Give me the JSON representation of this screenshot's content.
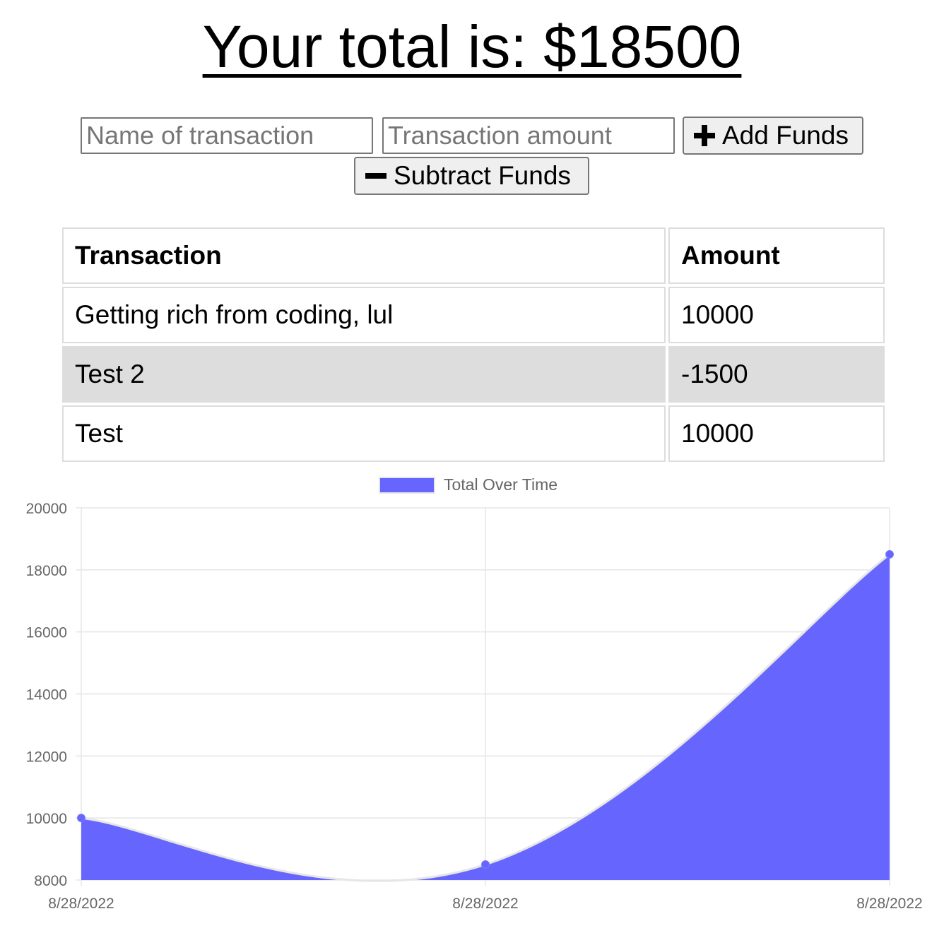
{
  "header": {
    "title": "Your total is: $18500"
  },
  "form": {
    "name_placeholder": "Name of transaction",
    "amount_placeholder": "Transaction amount",
    "add_label": "Add Funds",
    "subtract_label": "Subtract Funds"
  },
  "table": {
    "headers": [
      "Transaction",
      "Amount"
    ],
    "rows": [
      {
        "name": "Getting rich from coding, lul",
        "amount": "10000"
      },
      {
        "name": "Test 2",
        "amount": "-1500"
      },
      {
        "name": "Test",
        "amount": "10000"
      }
    ]
  },
  "colors": {
    "fill": "#6666ff",
    "line": "#e6e6e6",
    "row_alt": "#dddddd"
  },
  "chart_data": {
    "type": "area",
    "x": [
      "8/28/2022",
      "8/28/2022",
      "8/28/2022"
    ],
    "series": [
      {
        "name": "Total Over Time",
        "values": [
          10000,
          8500,
          18500
        ]
      }
    ],
    "ylim": [
      8000,
      20000
    ],
    "yticks": [
      8000,
      10000,
      12000,
      14000,
      16000,
      18000,
      20000
    ],
    "grid": true,
    "legend": "top-center"
  }
}
